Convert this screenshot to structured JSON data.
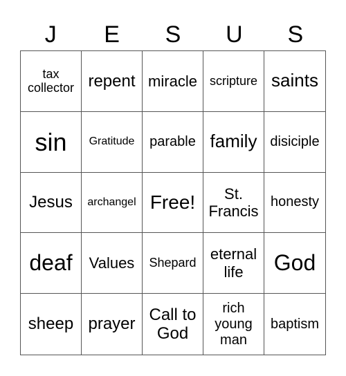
{
  "header": [
    "J",
    "E",
    "S",
    "U",
    "S"
  ],
  "cells": [
    "tax collector",
    "repent",
    "miracle",
    "scripture",
    "saints",
    "sin",
    "Gratitude",
    "parable",
    "family",
    "disiciple",
    "Jesus",
    "archangel",
    "Free!",
    "St. Francis",
    "honesty",
    "deaf",
    "Values",
    "Shepard",
    "eternal life",
    "God",
    "sheep",
    "prayer",
    "Call to God",
    "rich young man",
    "baptism"
  ]
}
